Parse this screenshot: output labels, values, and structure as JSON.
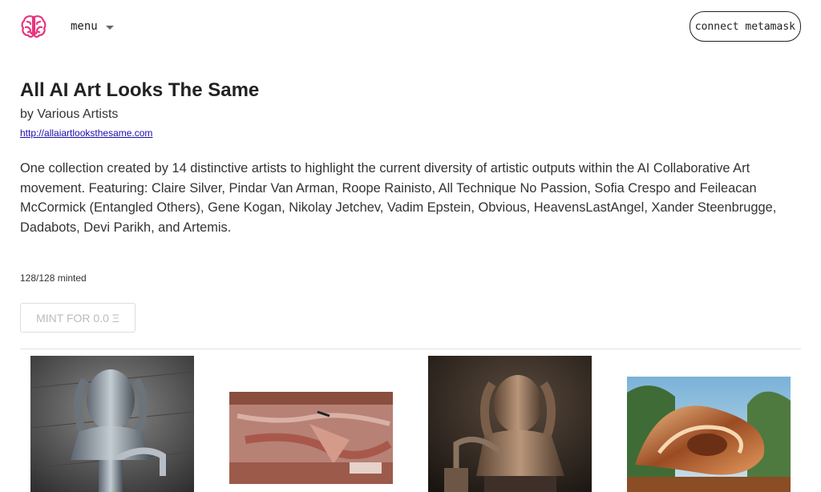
{
  "header": {
    "menu_label": "menu",
    "connect_label": "connect metamask",
    "logo_icon": "brain-icon",
    "logo_color": "#e8337e"
  },
  "collection": {
    "title": "All AI Art Looks The Same",
    "byline": "by Various Artists",
    "link": "http://allaiartlooksthesame.com",
    "description": "One collection created by 14 distinctive artists to highlight the current diversity of artistic outputs within the AI Collaborative Art movement. Featuring: Claire Silver, Pindar Van Arman, Roope Rainisto, All Technique No Passion, Sofia Crespo and Feileacan McCormick (Entangled Others), Gene Kogan, Nikolay Jetchev, Vadim Epstein, Obvious, HeavensLastAngel, Xander Steenbrugge, Dadabots, Devi Parikh, and Artemis.",
    "minted": "128/128 minted",
    "mint_button": "MINT FOR 0.0 Ξ"
  }
}
